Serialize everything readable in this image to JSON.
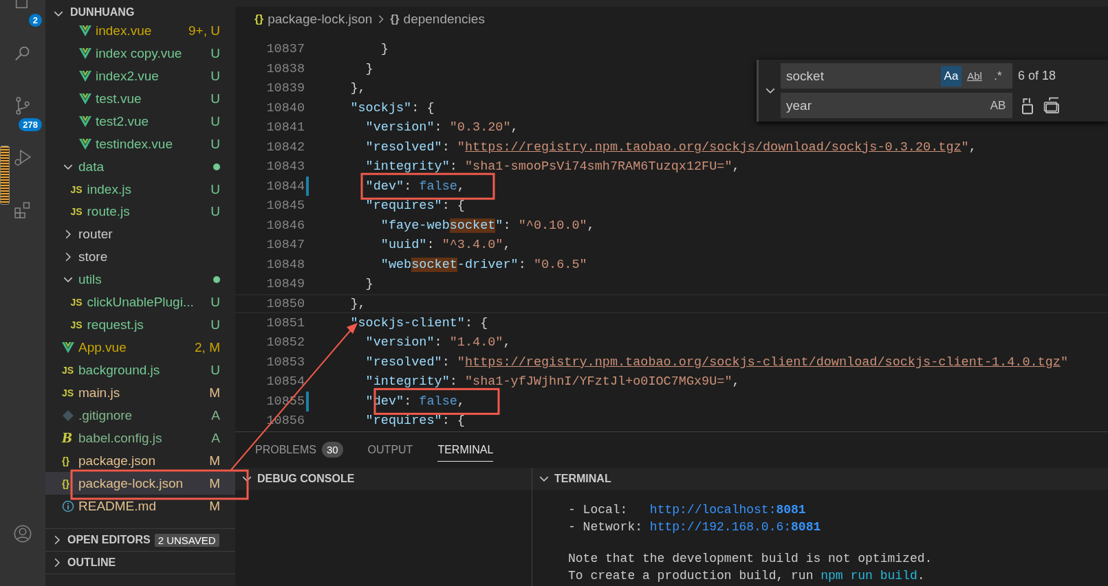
{
  "activity_bar": {
    "items": [
      {
        "kind": "explorer",
        "badge": "2"
      },
      {
        "kind": "search"
      },
      {
        "kind": "source-control",
        "badge": "278"
      },
      {
        "kind": "run-debug"
      },
      {
        "kind": "extensions"
      }
    ],
    "bottom": [
      {
        "kind": "account"
      }
    ]
  },
  "sidebar": {
    "title": "DUNHUANG",
    "tree": [
      {
        "children": [
          {
            "children": [
              {
                "children": [
                  {
                    "label": "index.vue",
                    "kind": "vue",
                    "status": "9+, U",
                    "color": "#cca700"
                  },
                  {
                    "label": "index copy.vue",
                    "kind": "vue",
                    "status": "U",
                    "color": "#73c991"
                  },
                  {
                    "label": "index2.vue",
                    "kind": "vue",
                    "status": "U",
                    "color": "#73c991"
                  },
                  {
                    "label": "test.vue",
                    "kind": "vue",
                    "status": "U",
                    "color": "#73c991"
                  },
                  {
                    "label": "test2.vue",
                    "kind": "vue",
                    "status": "U",
                    "color": "#73c991"
                  },
                  {
                    "label": "testindex.vue",
                    "kind": "vue",
                    "status": "U",
                    "color": "#73c991"
                  }
                ]
              }
            ]
          },
          {
            "label": "data",
            "kind": "folder",
            "expanded": true,
            "dot": true,
            "color": "#73c991",
            "children": [
              {
                "label": "index.js",
                "kind": "label",
                "icon_label": "JS",
                "status": "U",
                "color": "#73c991"
              },
              {
                "label": "route.js",
                "kind": "label",
                "icon_label": "JS",
                "status": "U",
                "color": "#73c991"
              }
            ]
          },
          {
            "label": "router",
            "kind": "folder",
            "expanded": false,
            "color": "#cccccc"
          },
          {
            "label": "store",
            "kind": "folder",
            "expanded": false,
            "color": "#cccccc"
          },
          {
            "label": "utils",
            "kind": "folder",
            "expanded": true,
            "dot": true,
            "color": "#73c991",
            "children": [
              {
                "label": "clickUnablePlugi...",
                "kind": "label",
                "icon_label": "JS",
                "status": "U",
                "color": "#73c991"
              },
              {
                "label": "request.js",
                "kind": "label",
                "icon_label": "JS",
                "status": "U",
                "color": "#73c991"
              }
            ]
          },
          {
            "label": "App.vue",
            "kind": "vue",
            "status": "2, M",
            "color": "#cca700"
          },
          {
            "label": "background.js",
            "kind": "label",
            "icon_label": "JS",
            "status": "U",
            "color": "#73c991"
          },
          {
            "label": "main.js",
            "kind": "label",
            "icon_label": "JS",
            "status": "M",
            "color": "#e2c08d"
          }
        ]
      },
      {
        "label": ".gitignore",
        "kind": "git",
        "status": "A",
        "color": "#81b88b"
      },
      {
        "label": "babel.config.js",
        "kind": "label",
        "icon_label": "B",
        "status": "A",
        "color": "#81b88b"
      },
      {
        "label": "package.json",
        "kind": "label",
        "icon_label": "{}",
        "status": "M",
        "color": "#e2c08d"
      },
      {
        "label": "package-lock.json",
        "kind": "label",
        "icon_label": "{}",
        "status": "M",
        "color": "#e2c08d",
        "selected": true,
        "annotated": true
      },
      {
        "label": "README.md",
        "kind": "info",
        "status": "M",
        "color": "#e2c08d"
      }
    ],
    "sections": [
      {
        "title": "OPEN EDITORS",
        "badge": "2 UNSAVED",
        "expanded": false
      },
      {
        "title": "OUTLINE",
        "expanded": false
      }
    ]
  },
  "editor": {
    "breadcrumbs": [
      {
        "glyph": "{}",
        "label": "package-lock.json"
      },
      {
        "glyph": "{}",
        "label": "dependencies"
      }
    ],
    "lines": [
      {
        "number": "10837",
        "tokens": [
          {
            "kind": "punct",
            "text": "        }"
          }
        ]
      },
      {
        "number": "10838",
        "tokens": [
          {
            "kind": "punct",
            "text": "      }"
          }
        ]
      },
      {
        "number": "10839",
        "tokens": [
          {
            "kind": "punct",
            "text": "    },"
          }
        ]
      },
      {
        "number": "10840",
        "tokens": [
          {
            "kind": "key",
            "text": "    \"sockjs\""
          },
          {
            "kind": "punct",
            "text": ": {"
          }
        ]
      },
      {
        "number": "10841",
        "tokens": [
          {
            "kind": "key",
            "text": "      \"version\""
          },
          {
            "kind": "punct",
            "text": ": "
          },
          {
            "kind": "string",
            "text": "\"0.3.20\""
          },
          {
            "kind": "punct",
            "text": ","
          }
        ]
      },
      {
        "number": "10842",
        "tokens": [
          {
            "kind": "key",
            "text": "      \"resolved\""
          },
          {
            "kind": "punct",
            "text": ": "
          },
          {
            "kind": "string",
            "text": "\""
          },
          {
            "kind": "url",
            "text": "https://registry.npm.taobao.org/sockjs/download/sockjs-0.3.20.tgz"
          },
          {
            "kind": "string",
            "text": "\""
          },
          {
            "kind": "punct",
            "text": ","
          }
        ]
      },
      {
        "number": "10843",
        "tokens": [
          {
            "kind": "key",
            "text": "      \"integrity\""
          },
          {
            "kind": "punct",
            "text": ": "
          },
          {
            "kind": "string",
            "text": "\"sha1-smooPsVi74smh7RAM6Tuzqx12FU=\""
          },
          {
            "kind": "punct",
            "text": ","
          }
        ]
      },
      {
        "number": "10844",
        "modified": true,
        "annotated": true,
        "tokens": [
          {
            "kind": "key",
            "text": "      \"dev\""
          },
          {
            "kind": "punct",
            "text": ": "
          },
          {
            "kind": "bool",
            "text": "false"
          },
          {
            "kind": "punct",
            "text": ","
          }
        ]
      },
      {
        "number": "10845",
        "tokens": [
          {
            "kind": "key",
            "text": "      \"requires\""
          },
          {
            "kind": "punct",
            "text": ": {"
          }
        ]
      },
      {
        "number": "10846",
        "tokens": [
          {
            "kind": "key",
            "text": "        \"faye-web"
          },
          {
            "kind": "key",
            "text": "socket",
            "match": true
          },
          {
            "kind": "key",
            "text": "\""
          },
          {
            "kind": "punct",
            "text": ": "
          },
          {
            "kind": "string",
            "text": "\"^0.10.0\""
          },
          {
            "kind": "punct",
            "text": ","
          }
        ]
      },
      {
        "number": "10847",
        "tokens": [
          {
            "kind": "key",
            "text": "        \"uuid\""
          },
          {
            "kind": "punct",
            "text": ": "
          },
          {
            "kind": "string",
            "text": "\"^3.4.0\""
          },
          {
            "kind": "punct",
            "text": ","
          }
        ]
      },
      {
        "number": "10848",
        "tokens": [
          {
            "kind": "key",
            "text": "        \"web"
          },
          {
            "kind": "key",
            "text": "socket",
            "match": true
          },
          {
            "kind": "key",
            "text": "-driver\""
          },
          {
            "kind": "punct",
            "text": ": "
          },
          {
            "kind": "string",
            "text": "\"0.6.5\""
          }
        ]
      },
      {
        "number": "10849",
        "tokens": [
          {
            "kind": "punct",
            "text": "      }"
          }
        ]
      },
      {
        "number": "10850",
        "current": true,
        "tokens": [
          {
            "kind": "punct",
            "text": "    },"
          }
        ]
      },
      {
        "number": "10851",
        "tokens": [
          {
            "kind": "key",
            "text": "    \"sockjs-client\""
          },
          {
            "kind": "punct",
            "text": ": {"
          }
        ]
      },
      {
        "number": "10852",
        "tokens": [
          {
            "kind": "key",
            "text": "      \"version\""
          },
          {
            "kind": "punct",
            "text": ": "
          },
          {
            "kind": "string",
            "text": "\"1.4.0\""
          },
          {
            "kind": "punct",
            "text": ","
          }
        ]
      },
      {
        "number": "10853",
        "tokens": [
          {
            "kind": "key",
            "text": "      \"resolved\""
          },
          {
            "kind": "punct",
            "text": ": "
          },
          {
            "kind": "string",
            "text": "\""
          },
          {
            "kind": "url",
            "text": "https://registry.npm.taobao.org/sockjs-client/download/sockjs-client-1.4.0.tgz"
          },
          {
            "kind": "string",
            "text": "\""
          }
        ]
      },
      {
        "number": "10854",
        "tokens": [
          {
            "kind": "key",
            "text": "      \"integrity\""
          },
          {
            "kind": "punct",
            "text": ": "
          },
          {
            "kind": "string",
            "text": "\"sha1-yfJWjhnI/YFztJl+o0IOC7MGx9U=\""
          },
          {
            "kind": "punct",
            "text": ","
          }
        ]
      },
      {
        "number": "10855",
        "modified": true,
        "annotated": true,
        "tokens": [
          {
            "kind": "key",
            "text": "      \"dev\""
          },
          {
            "kind": "punct",
            "text": ": "
          },
          {
            "kind": "bool",
            "text": "false"
          },
          {
            "kind": "punct",
            "text": ","
          }
        ]
      },
      {
        "number": "10856",
        "tokens": [
          {
            "kind": "key",
            "text": "      \"requires\""
          },
          {
            "kind": "punct",
            "text": ": {"
          }
        ]
      }
    ],
    "find": {
      "expanded": true,
      "query": "socket",
      "options": [
        {
          "kind": "case",
          "label": "Aa",
          "selected": true
        },
        {
          "kind": "word",
          "label": "Abl",
          "selected": false
        },
        {
          "kind": "regex",
          "label": ".*",
          "selected": false
        }
      ],
      "count": "6 of 18",
      "replace": "year",
      "replace_options": [
        {
          "label": "AB",
          "selected": false
        }
      ]
    }
  },
  "panel": {
    "tabs": [
      {
        "label": "PROBLEMS",
        "badge": "30",
        "selected": false
      },
      {
        "label": "OUTPUT",
        "selected": false
      },
      {
        "label": "TERMINAL",
        "selected": true
      }
    ],
    "views": [
      {
        "title": "DEBUG CONSOLE",
        "expanded": true
      },
      {
        "title": "TERMINAL",
        "expanded": true,
        "lines": [
          {
            "tokens": [
              {
                "kind": "text",
                "text": "- Local:   "
              },
              {
                "kind": "link",
                "text": "http://localhost:"
              },
              {
                "kind": "link-bold",
                "text": "8081"
              }
            ]
          },
          {
            "tokens": [
              {
                "kind": "text",
                "text": "- Network: "
              },
              {
                "kind": "link",
                "text": "http://192.168.0.6:"
              },
              {
                "kind": "link-bold",
                "text": "8081"
              }
            ]
          },
          {
            "spaced": true,
            "tokens": [
              {
                "kind": "text",
                "text": "Note that the development build is not optimized."
              }
            ]
          },
          {
            "tokens": [
              {
                "kind": "text",
                "text": "To create a production build, run "
              },
              {
                "kind": "command",
                "text": "npm run build"
              },
              {
                "kind": "text",
                "text": "."
              }
            ]
          }
        ]
      }
    ]
  }
}
